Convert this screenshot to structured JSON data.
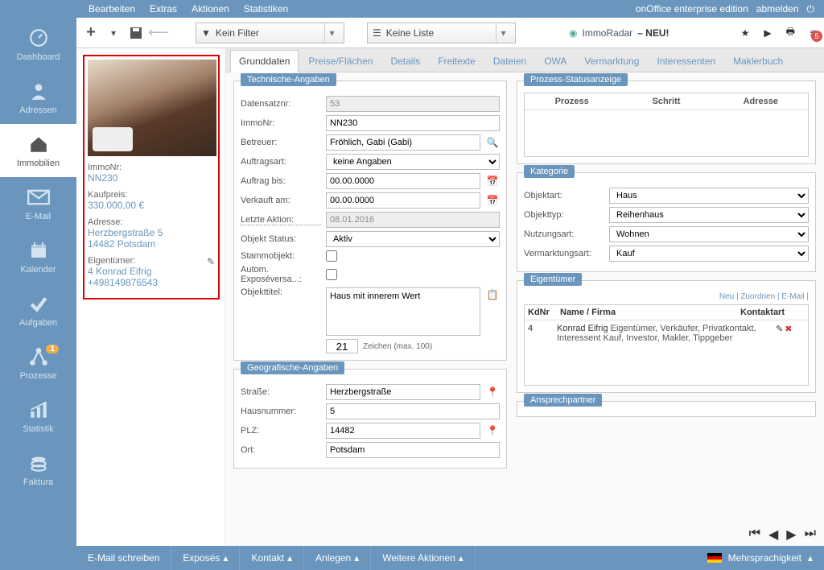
{
  "topbar": {
    "menu": [
      "Bearbeiten",
      "Extras",
      "Aktionen",
      "Statistiken"
    ],
    "edition": "onOffice enterprise edition",
    "logout": "abmelden"
  },
  "sidebar": {
    "items": [
      {
        "label": "Dashboard",
        "icon": "dashboard"
      },
      {
        "label": "Adressen",
        "icon": "person"
      },
      {
        "label": "Immobilien",
        "icon": "house",
        "active": true
      },
      {
        "label": "E-Mail",
        "icon": "mail"
      },
      {
        "label": "Kalender",
        "icon": "calendar"
      },
      {
        "label": "Aufgaben",
        "icon": "check"
      },
      {
        "label": "Prozesse",
        "icon": "branch",
        "badge": "1"
      },
      {
        "label": "Statistik",
        "icon": "stats"
      },
      {
        "label": "Faktura",
        "icon": "coins"
      }
    ]
  },
  "toolbar": {
    "filter": "Kein Filter",
    "list": "Keine Liste",
    "immoradar_label": "ImmoRadar",
    "immoradar_new": "– NEU!",
    "badge": "5"
  },
  "card": {
    "immonr_label": "ImmoNr:",
    "immonr": "NN230",
    "price_label": "Kaufpreis:",
    "price": "330.000,00 €",
    "addr_label": "Adresse:",
    "addr1": "Herzbergstraße 5",
    "addr2": "14482 Potsdam",
    "owner_label": "Eigentümer:",
    "owner1": "4 Konrad Eifrig",
    "owner2": "+498149876543"
  },
  "tabs": [
    "Grunddaten",
    "Preise/Flächen",
    "Details",
    "Freitexte",
    "Dateien",
    "OWA",
    "Vermarktung",
    "Interessenten",
    "Maklerbuch"
  ],
  "active_tab": 0,
  "tech": {
    "title": "Technische-Angaben",
    "datensatz_label": "Datensatznr:",
    "datensatz": "53",
    "immonr_label": "ImmoNr:",
    "immonr": "NN230",
    "betreuer_label": "Betreuer:",
    "betreuer": "Fröhlich, Gabi (Gabi)",
    "auftragsart_label": "Auftragsart:",
    "auftragsart": "keine Angaben",
    "auftragbis_label": "Auftrag bis:",
    "auftragbis": "00.00.0000",
    "verkauftam_label": "Verkauft am:",
    "verkauftam": "00.00.0000",
    "letzteaktion_label": "Letzte Aktion:",
    "letzteaktion": "08.01.2016",
    "status_label": "Objekt Status:",
    "status": "Aktiv",
    "stamm_label": "Stammobjekt:",
    "expose_label": "Autom. Exposéversa...:",
    "titel_label": "Objekttitel:",
    "titel": "Haus mit innerem Wert",
    "char_count": "21",
    "char_hint": "Zeichen (max. 100)"
  },
  "geo": {
    "title": "Geografische-Angaben",
    "strasse_label": "Straße:",
    "strasse": "Herzbergstraße",
    "hausnr_label": "Hausnummer:",
    "hausnr": "5",
    "plz_label": "PLZ:",
    "plz": "14482",
    "ort_label": "Ort:",
    "ort": "Potsdam"
  },
  "process": {
    "title": "Prozess-Statusanzeige",
    "h1": "Prozess",
    "h2": "Schritt",
    "h3": "Adresse"
  },
  "kategorie": {
    "title": "Kategorie",
    "objektart_label": "Objektart:",
    "objektart": "Haus",
    "objekttyp_label": "Objekttyp:",
    "objekttyp": "Reihenhaus",
    "nutzung_label": "Nutzungsart:",
    "nutzung": "Wohnen",
    "vermarkt_label": "Vermarktungsart:",
    "vermarkt": "Kauf"
  },
  "owner": {
    "title": "Eigentümer",
    "links": "Neu | Zuordnen | E-Mail |",
    "h1": "KdNr",
    "h2": "Name / Firma",
    "h3": "Kontaktart",
    "kdnr": "4",
    "name": "Konrad Eifrig",
    "kontaktart": "Eigentümer, Verkäufer, Privatkontakt, Interessent Kauf, Investor, Makler, Tippgeber"
  },
  "ansprech": {
    "title": "Ansprechpartner"
  },
  "footer": {
    "items": [
      "E-Mail schreiben",
      "Exposés",
      "Kontakt",
      "Anlegen",
      "Weitere Aktionen"
    ],
    "lang": "Mehrsprachigkeit"
  }
}
